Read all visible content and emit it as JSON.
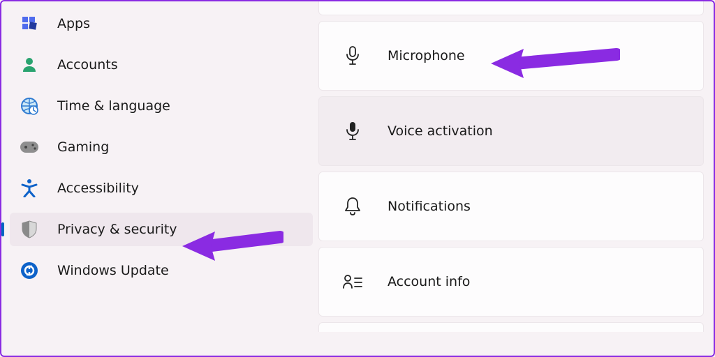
{
  "sidebar": {
    "items": [
      {
        "label": "Apps",
        "icon": "apps"
      },
      {
        "label": "Accounts",
        "icon": "accounts"
      },
      {
        "label": "Time & language",
        "icon": "time-language"
      },
      {
        "label": "Gaming",
        "icon": "gaming"
      },
      {
        "label": "Accessibility",
        "icon": "accessibility"
      },
      {
        "label": "Privacy & security",
        "icon": "privacy"
      },
      {
        "label": "Windows Update",
        "icon": "update"
      }
    ],
    "active_index": 5
  },
  "main": {
    "items": [
      {
        "label": "Microphone",
        "icon": "microphone-outline"
      },
      {
        "label": "Voice activation",
        "icon": "microphone-solid"
      },
      {
        "label": "Notifications",
        "icon": "notifications"
      },
      {
        "label": "Account info",
        "icon": "account-info"
      }
    ],
    "selected_index": 1
  },
  "annotations": {
    "arrow_color": "#8a2be2",
    "arrows": [
      {
        "target": "microphone-card"
      },
      {
        "target": "privacy-security-nav"
      }
    ]
  }
}
